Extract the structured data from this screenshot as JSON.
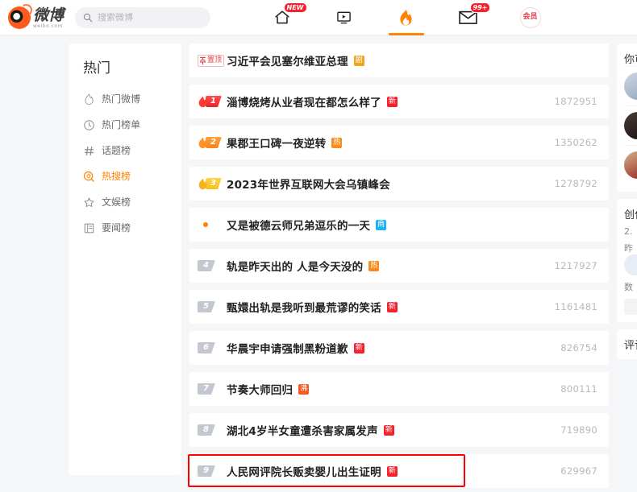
{
  "header": {
    "logo_cn": "微博",
    "logo_en": "weibo.com",
    "search_placeholder": "搜索微博",
    "search_value": "",
    "nav": [
      {
        "name": "home",
        "icon": "home-icon",
        "badge": "NEW",
        "active": false
      },
      {
        "name": "video",
        "icon": "video-icon",
        "badge": "",
        "active": false
      },
      {
        "name": "hot",
        "icon": "flame-icon",
        "badge": "",
        "active": true
      },
      {
        "name": "message",
        "icon": "envelope-icon",
        "badge": "99+",
        "active": false
      },
      {
        "name": "vip",
        "icon": "vip-icon",
        "badge": "",
        "active": false,
        "label": "会员"
      }
    ]
  },
  "sidebar": {
    "title": "热门",
    "items": [
      {
        "label": "热门微博",
        "icon": "flame-outline-icon",
        "active": false
      },
      {
        "label": "热门榜单",
        "icon": "clock-icon",
        "active": false
      },
      {
        "label": "话题榜",
        "icon": "hash-icon",
        "active": false
      },
      {
        "label": "热搜榜",
        "icon": "search-rank-icon",
        "active": true
      },
      {
        "label": "文娱榜",
        "icon": "star-icon",
        "active": false
      },
      {
        "label": "要闻榜",
        "icon": "news-icon",
        "active": false
      }
    ]
  },
  "hotlist": {
    "pinned": {
      "badge_label": "置顶",
      "title": "习近平会见塞尔维亚总理",
      "tag": "剧",
      "tag_kind": "ju",
      "count": ""
    },
    "rows": [
      {
        "rank": "1",
        "rank_kind": "flame-r1",
        "title": "淄博烧烤从业者现在都怎么样了",
        "tag": "新",
        "tag_kind": "xin",
        "count": "1872951"
      },
      {
        "rank": "2",
        "rank_kind": "flame-r2",
        "title": "果郡王口碑一夜逆转",
        "tag": "热",
        "tag_kind": "re",
        "count": "1350262"
      },
      {
        "rank": "3",
        "rank_kind": "flame-r3",
        "title": "2023年世界互联网大会乌镇峰会",
        "tag": "",
        "tag_kind": "",
        "count": "1278792"
      },
      {
        "rank": "",
        "rank_kind": "dot",
        "title": "又是被德云师兄弟逗乐的一天",
        "tag": "商",
        "tag_kind": "shang",
        "count": ""
      },
      {
        "rank": "4",
        "rank_kind": "gray",
        "title": "轨是昨天出的 人是今天没的",
        "tag": "热",
        "tag_kind": "re",
        "count": "1217927"
      },
      {
        "rank": "5",
        "rank_kind": "gray",
        "title": "甄嬛出轨是我听到最荒谬的笑话",
        "tag": "新",
        "tag_kind": "xin",
        "count": "1161481"
      },
      {
        "rank": "6",
        "rank_kind": "gray",
        "title": "华晨宇申请强制黑粉道歉",
        "tag": "新",
        "tag_kind": "xin",
        "count": "826754"
      },
      {
        "rank": "7",
        "rank_kind": "gray",
        "title": "节奏大师回归",
        "tag": "沸",
        "tag_kind": "fei",
        "count": "800111"
      },
      {
        "rank": "8",
        "rank_kind": "gray",
        "title": "湖北4岁半女童遭杀害家属发声",
        "tag": "新",
        "tag_kind": "xin",
        "count": "719890"
      },
      {
        "rank": "9",
        "rank_kind": "gray",
        "title": "人民网评院长贩卖婴儿出生证明",
        "tag": "新",
        "tag_kind": "xin",
        "count": "629967"
      }
    ],
    "highlighted_row_index": 9,
    "highlight_color": "#ff0000"
  },
  "right_rail": {
    "suggest_title": "你可",
    "creator_title": "创作",
    "creator_value": "2.",
    "creator_sub": "昨",
    "stats_label": "数",
    "comment_title": "评论"
  },
  "colors": {
    "accent": "#ff8200",
    "badge_red": "#f5222d",
    "page_bg": "#f5f6f7",
    "card_bg": "#ffffff"
  }
}
